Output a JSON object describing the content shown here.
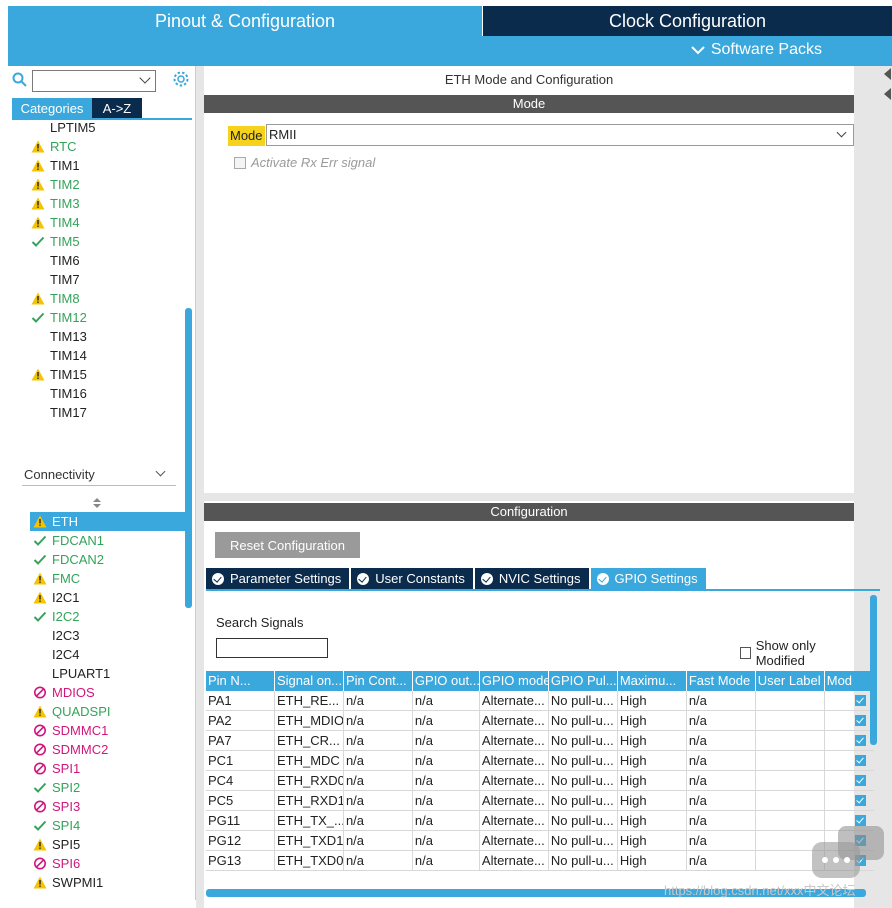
{
  "header": {
    "pinout_tab": "Pinout & Configuration",
    "clock_tab": "Clock Configuration",
    "software_packs": "Software Packs"
  },
  "sidebar": {
    "tabs": {
      "categories": "Categories",
      "az": "A->Z"
    },
    "timers": [
      {
        "label": "LPTIM5",
        "status": "none",
        "color": "black"
      },
      {
        "label": "RTC",
        "status": "warning",
        "color": "green"
      },
      {
        "label": "TIM1",
        "status": "warning",
        "color": "black"
      },
      {
        "label": "TIM2",
        "status": "warning",
        "color": "green"
      },
      {
        "label": "TIM3",
        "status": "warning",
        "color": "green"
      },
      {
        "label": "TIM4",
        "status": "warning",
        "color": "green"
      },
      {
        "label": "TIM5",
        "status": "check",
        "color": "green"
      },
      {
        "label": "TIM6",
        "status": "none",
        "color": "black"
      },
      {
        "label": "TIM7",
        "status": "none",
        "color": "black"
      },
      {
        "label": "TIM8",
        "status": "warning",
        "color": "green"
      },
      {
        "label": "TIM12",
        "status": "check",
        "color": "green"
      },
      {
        "label": "TIM13",
        "status": "none",
        "color": "black"
      },
      {
        "label": "TIM14",
        "status": "none",
        "color": "black"
      },
      {
        "label": "TIM15",
        "status": "warning",
        "color": "black"
      },
      {
        "label": "TIM16",
        "status": "none",
        "color": "black"
      },
      {
        "label": "TIM17",
        "status": "none",
        "color": "black"
      }
    ],
    "connectivity_header": "Connectivity",
    "connectivity": [
      {
        "label": "ETH",
        "status": "warning",
        "color": "white",
        "selected": true
      },
      {
        "label": "FDCAN1",
        "status": "check",
        "color": "green"
      },
      {
        "label": "FDCAN2",
        "status": "check",
        "color": "green"
      },
      {
        "label": "FMC",
        "status": "warning",
        "color": "green"
      },
      {
        "label": "I2C1",
        "status": "warning",
        "color": "black"
      },
      {
        "label": "I2C2",
        "status": "check",
        "color": "green"
      },
      {
        "label": "I2C3",
        "status": "none",
        "color": "black"
      },
      {
        "label": "I2C4",
        "status": "none",
        "color": "black"
      },
      {
        "label": "LPUART1",
        "status": "none",
        "color": "black"
      },
      {
        "label": "MDIOS",
        "status": "blocked",
        "color": "pink"
      },
      {
        "label": "QUADSPI",
        "status": "warning",
        "color": "green"
      },
      {
        "label": "SDMMC1",
        "status": "blocked",
        "color": "pink"
      },
      {
        "label": "SDMMC2",
        "status": "blocked",
        "color": "pink"
      },
      {
        "label": "SPI1",
        "status": "blocked",
        "color": "pink"
      },
      {
        "label": "SPI2",
        "status": "check",
        "color": "green"
      },
      {
        "label": "SPI3",
        "status": "blocked",
        "color": "pink"
      },
      {
        "label": "SPI4",
        "status": "check",
        "color": "green"
      },
      {
        "label": "SPI5",
        "status": "warning",
        "color": "black"
      },
      {
        "label": "SPI6",
        "status": "blocked",
        "color": "pink"
      },
      {
        "label": "SWPMI1",
        "status": "warning",
        "color": "black"
      }
    ]
  },
  "mode_panel": {
    "title": "ETH Mode and Configuration",
    "section": "Mode",
    "mode_label": "Mode",
    "mode_value": "RMII",
    "rx_err_label": "Activate Rx Err signal"
  },
  "config_panel": {
    "section": "Configuration",
    "reset_button": "Reset Configuration",
    "tabs": [
      "Parameter Settings",
      "User Constants",
      "NVIC Settings",
      "GPIO Settings"
    ],
    "search_label": "Search Signals",
    "show_modified": "Show only Modified",
    "columns": [
      "Pin N...",
      "Signal on...",
      "Pin Cont...",
      "GPIO out...",
      "GPIO mode",
      "GPIO Pul...",
      "Maximu...",
      "Fast Mode",
      "User Label",
      "Mod"
    ],
    "rows": [
      [
        "PA1",
        "ETH_RE...",
        "n/a",
        "n/a",
        "Alternate...",
        "No pull-u...",
        "High",
        "n/a",
        ""
      ],
      [
        "PA2",
        "ETH_MDIO",
        "n/a",
        "n/a",
        "Alternate...",
        "No pull-u...",
        "High",
        "n/a",
        ""
      ],
      [
        "PA7",
        "ETH_CR...",
        "n/a",
        "n/a",
        "Alternate...",
        "No pull-u...",
        "High",
        "n/a",
        ""
      ],
      [
        "PC1",
        "ETH_MDC",
        "n/a",
        "n/a",
        "Alternate...",
        "No pull-u...",
        "High",
        "n/a",
        ""
      ],
      [
        "PC4",
        "ETH_RXD0",
        "n/a",
        "n/a",
        "Alternate...",
        "No pull-u...",
        "High",
        "n/a",
        ""
      ],
      [
        "PC5",
        "ETH_RXD1",
        "n/a",
        "n/a",
        "Alternate...",
        "No pull-u...",
        "High",
        "n/a",
        ""
      ],
      [
        "PG11",
        "ETH_TX_...",
        "n/a",
        "n/a",
        "Alternate...",
        "No pull-u...",
        "High",
        "n/a",
        ""
      ],
      [
        "PG12",
        "ETH_TXD1",
        "n/a",
        "n/a",
        "Alternate...",
        "No pull-u...",
        "High",
        "n/a",
        ""
      ],
      [
        "PG13",
        "ETH_TXD0",
        "n/a",
        "n/a",
        "Alternate...",
        "No pull-u...",
        "High",
        "n/a",
        ""
      ]
    ]
  },
  "watermark": "https://blog.csdn.net/xxx中文论坛",
  "colors": {
    "accent": "#3aa8dc",
    "navy": "#0a2b4c",
    "warning": "#f5c400",
    "ok": "#33a35a",
    "blocked": "#d0167d"
  }
}
